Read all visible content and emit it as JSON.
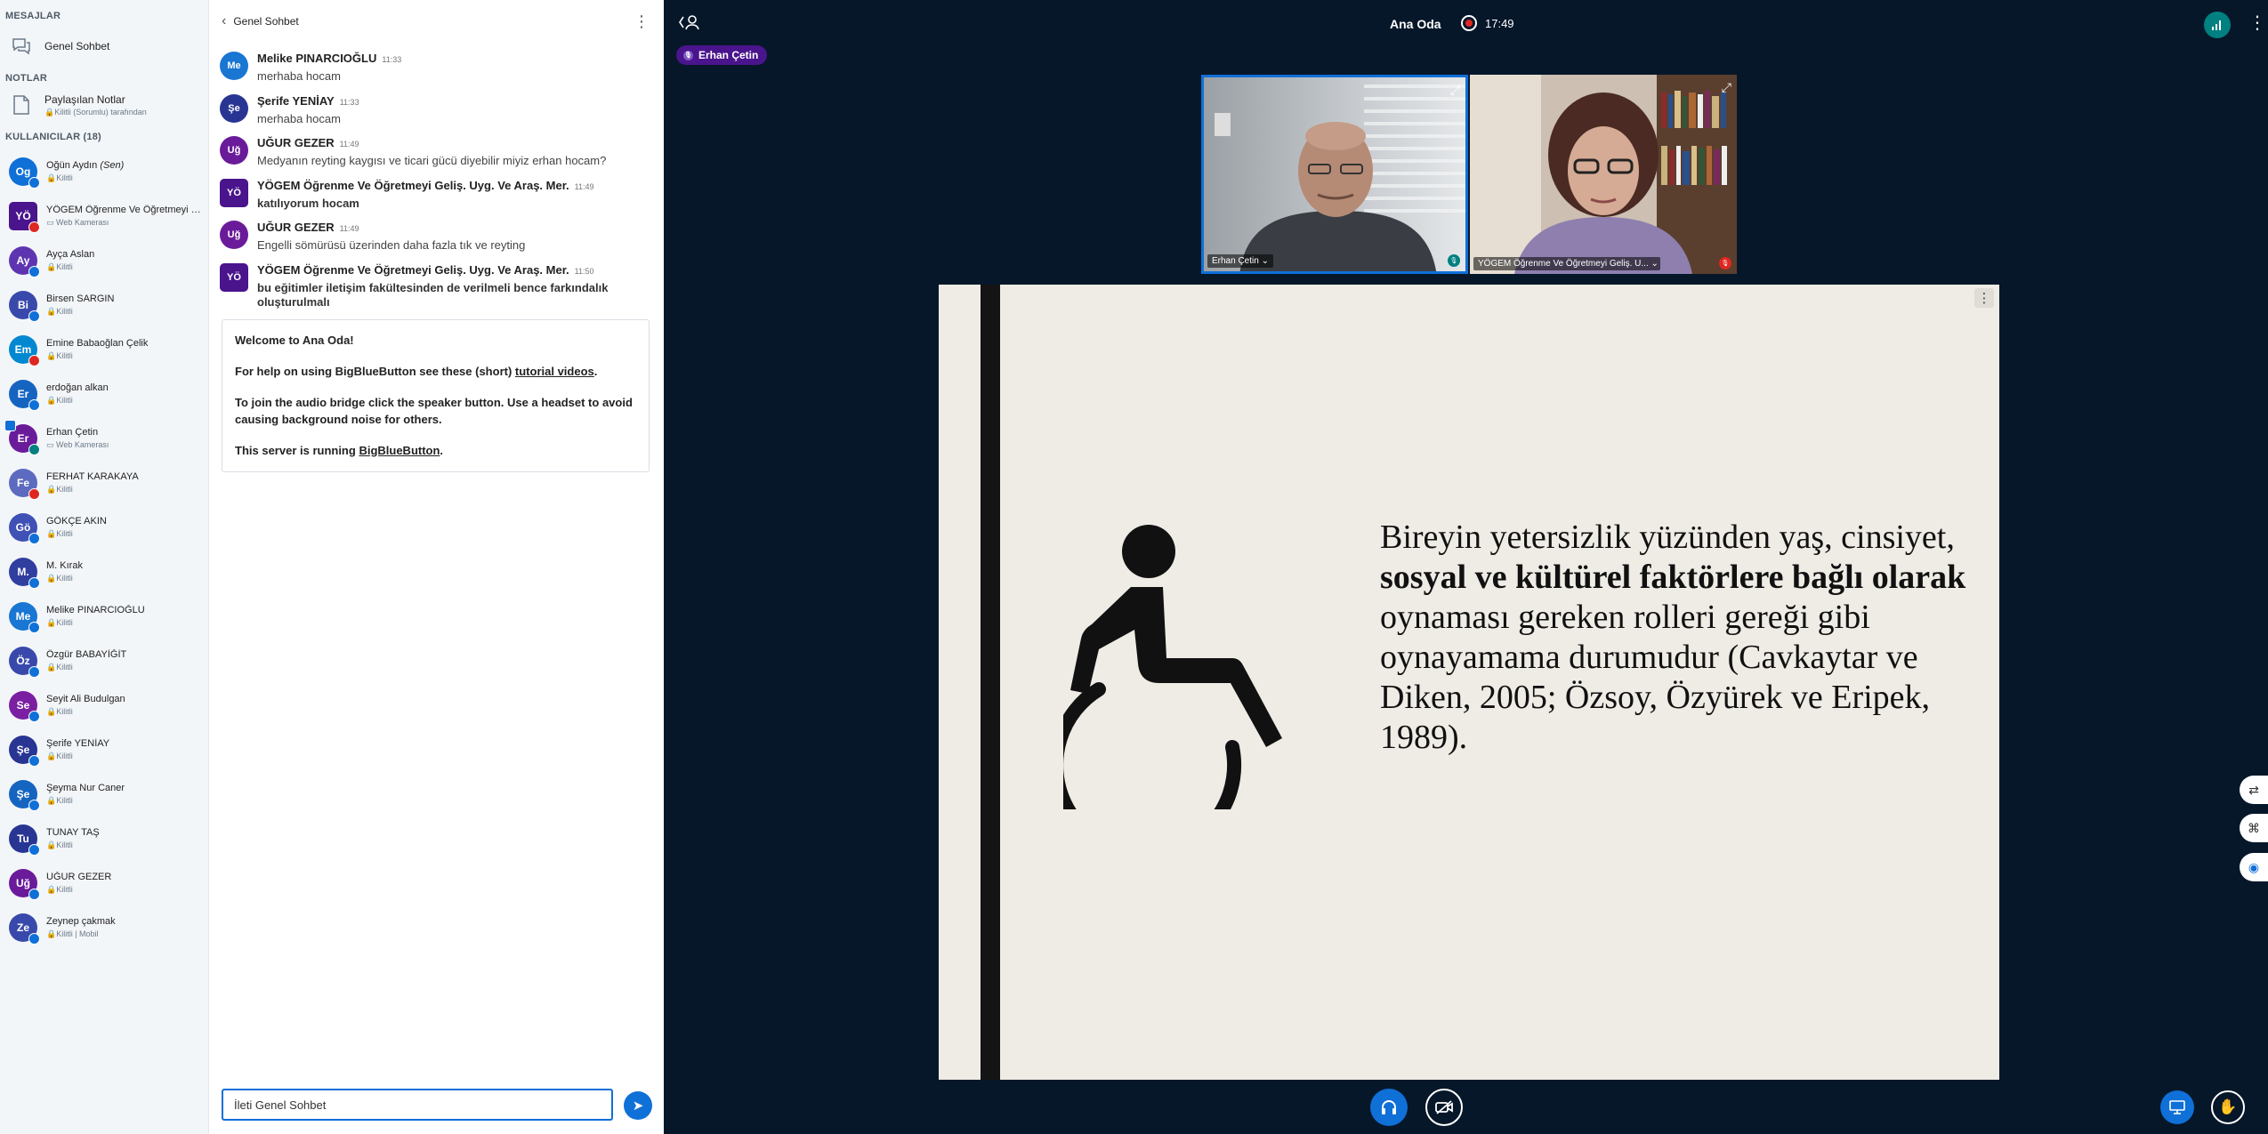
{
  "sidebar": {
    "messages_title": "MESAJLAR",
    "public_chat_label": "Genel Sohbet",
    "notes_title": "NOTLAR",
    "shared_notes_label": "Paylaşılan Notlar",
    "shared_notes_sub": "🔒Kilitli (Sorumlu) tarafından",
    "users_title": "KULLANICILAR (18)",
    "users": [
      {
        "initials": "Og",
        "name": "Oğün Aydın",
        "you": "(Sen)",
        "sub": "🔒Kilitli",
        "color": "#0F70D7",
        "mic": "blue"
      },
      {
        "initials": "YÖ",
        "name": "YÖGEM Öğrenme Ve Öğretmeyi Geliş. Uyg. Ve Araş. Mer.",
        "you": "",
        "sub": "▭ Web Kamerası",
        "color": "#4A148C",
        "mic": "muted"
      },
      {
        "initials": "Ay",
        "name": "Ayça Aslan",
        "you": "",
        "sub": "🔒Kilitli",
        "color": "#5E35B1",
        "mic": "blue"
      },
      {
        "initials": "Bi",
        "name": "Birsen SARGIN",
        "you": "",
        "sub": "🔒Kilitli",
        "color": "#3949AB",
        "mic": "blue"
      },
      {
        "initials": "Em",
        "name": "Emine Babaoğlan Çelik",
        "you": "",
        "sub": "🔒Kilitli",
        "color": "#0288D1",
        "mic": "muted"
      },
      {
        "initials": "Er",
        "name": "erdoğan alkan",
        "you": "",
        "sub": "🔒Kilitli",
        "color": "#1565C0",
        "mic": "blue"
      },
      {
        "initials": "Er",
        "name": "Erhan Çetin",
        "you": "",
        "sub": "▭ Web Kamerası",
        "color": "#6A1B9A",
        "mic": "on"
      },
      {
        "initials": "Fe",
        "name": "FERHAT KARAKAYA",
        "you": "",
        "sub": "🔒Kilitli",
        "color": "#5C6BC0",
        "mic": "muted"
      },
      {
        "initials": "Gö",
        "name": "GÖKÇE AKIN",
        "you": "",
        "sub": "🔒Kilitli",
        "color": "#3F51B5",
        "mic": "blue"
      },
      {
        "initials": "M.",
        "name": "M. Kırak",
        "you": "",
        "sub": "🔒Kilitli",
        "color": "#303F9F",
        "mic": "blue"
      },
      {
        "initials": "Me",
        "name": "Melike PINARCIOĞLU",
        "you": "",
        "sub": "🔒Kilitli",
        "color": "#1976D2",
        "mic": "blue"
      },
      {
        "initials": "Öz",
        "name": "Özgür BABAYİĞİT",
        "you": "",
        "sub": "🔒Kilitli",
        "color": "#3949AB",
        "mic": "blue"
      },
      {
        "initials": "Se",
        "name": "Seyit Ali Budulgan",
        "you": "",
        "sub": "🔒Kilitli",
        "color": "#7B1FA2",
        "mic": "blue"
      },
      {
        "initials": "Şe",
        "name": "Şerife YENİAY",
        "you": "",
        "sub": "🔒Kilitli",
        "color": "#283593",
        "mic": "blue"
      },
      {
        "initials": "Şe",
        "name": "Şeyma Nur Caner",
        "you": "",
        "sub": "🔒Kilitli",
        "color": "#1565C0",
        "mic": "blue"
      },
      {
        "initials": "Tu",
        "name": "TUNAY TAŞ",
        "you": "",
        "sub": "🔒Kilitli",
        "color": "#283593",
        "mic": "blue"
      },
      {
        "initials": "Uğ",
        "name": "UĞUR GEZER",
        "you": "",
        "sub": "🔒Kilitli",
        "color": "#6A1B9A",
        "mic": "blue"
      },
      {
        "initials": "Ze",
        "name": "Zeynep çakmak",
        "you": "",
        "sub": "🔒Kilitli | Mobil",
        "color": "#3949AB",
        "mic": "blue"
      }
    ]
  },
  "chat": {
    "header_title": "Genel Sohbet",
    "messages": [
      {
        "initials": "Me",
        "name": "Melike PINARCIOĞLU",
        "time": "11:33",
        "text": "merhaba hocam",
        "color": "#1976D2",
        "bold": false
      },
      {
        "initials": "Şe",
        "name": "Şerife YENİAY",
        "time": "11:33",
        "text": "merhaba hocam",
        "color": "#283593",
        "bold": false
      },
      {
        "initials": "Uğ",
        "name": "UĞUR GEZER",
        "time": "11:49",
        "text": "Medyanın reyting kaygısı ve ticari gücü diyebilir miyiz erhan hocam?",
        "color": "#6A1B9A",
        "bold": false
      },
      {
        "initials": "YÖ",
        "name": "YÖGEM Öğrenme Ve Öğretmeyi Geliş. Uyg. Ve Araş. Mer.",
        "time": "11:49",
        "text": "katılıyorum hocam",
        "color": "#4A148C",
        "bold": true
      },
      {
        "initials": "Uğ",
        "name": "UĞUR GEZER",
        "time": "11:49",
        "text": "Engelli sömürüsü üzerinden daha fazla tık ve reyting",
        "color": "#6A1B9A",
        "bold": false
      },
      {
        "initials": "YÖ",
        "name": "YÖGEM Öğrenme Ve Öğretmeyi Geliş. Uyg. Ve Araş. Mer.",
        "time": "11:50",
        "text": "bu eğitimler iletişim fakültesinden de verilmeli bence farkındalık oluşturulmalı",
        "color": "#4A148C",
        "bold": true
      }
    ],
    "welcome": {
      "line1": "Welcome to Ana Oda!",
      "line2_pre": "For help on using BigBlueButton see these (short) ",
      "line2_link": "tutorial videos",
      "line2_post": ".",
      "line3": "To join the audio bridge click the speaker button. Use a headset to avoid causing background noise for others.",
      "line4_pre": "This server is running ",
      "line4_link": "BigBlueButton",
      "line4_post": "."
    },
    "input_value": "İleti Genel Sohbet"
  },
  "topbar": {
    "room_title": "Ana Oda",
    "recording_time": "17:49",
    "talking_user": "Erhan Çetin"
  },
  "videos": [
    {
      "label": "Erhan Çetin ⌄",
      "active": true
    },
    {
      "label": "YÖGEM Öğrenme Ve Öğretmeyi Geliş. U... ⌄",
      "active": false
    }
  ],
  "slide": {
    "text_part1": "Bireyin yetersizlik yüzünden yaş, cinsiyet, ",
    "text_bold": "sosyal ve kültürel faktörlere bağlı olarak",
    "text_part2": "  oynaması gereken rolleri gereği gibi oynayamama durumudur (Cavkaytar ve Diken, 2005; Özsoy, Özyürek ve Eripek, 1989)."
  },
  "colors": {
    "accent": "#0F70D7",
    "main_bg": "#06172A",
    "muted": "#DF2721",
    "talking": "#4A148C"
  }
}
